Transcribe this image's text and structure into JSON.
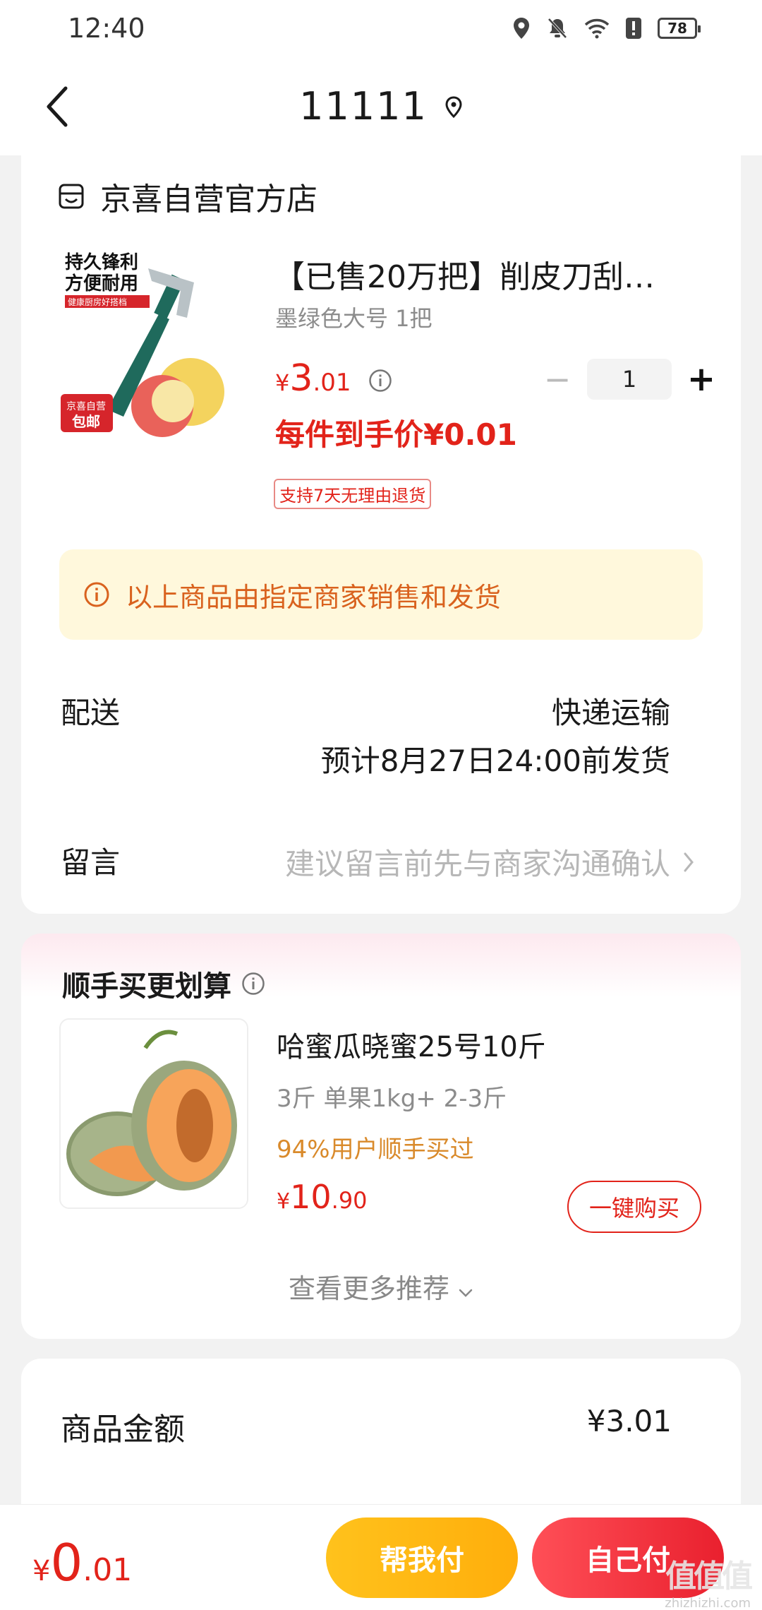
{
  "status_bar": {
    "time": "12:40",
    "battery": "78"
  },
  "header": {
    "title": "11111"
  },
  "store": {
    "name": "京喜自营官方店"
  },
  "product": {
    "image_text_line1": "持久锋利",
    "image_text_line2": "方便耐用",
    "image_text_line3": "健康厨房好搭档",
    "image_tag_line1": "京喜自营",
    "image_tag_line2": "包邮",
    "title": "【已售20万把】削皮刀刮…",
    "spec": "墨绿色大号 1把",
    "price_currency": "¥",
    "price_int": "3",
    "price_dec": ".01",
    "quantity": "1",
    "minus_label": "−",
    "plus_label": "+",
    "deal_price": "每件到手价¥0.01",
    "badge": "支持7天无理由退货"
  },
  "notice": {
    "text": "以上商品由指定商家销售和发货"
  },
  "delivery": {
    "label": "配送",
    "method": "快递运输",
    "eta": "预计8月27日24:00前发货"
  },
  "message": {
    "label": "留言",
    "placeholder": "建议留言前先与商家沟通确认"
  },
  "recommend": {
    "title": "顺手买更划算",
    "item": {
      "name": "哈蜜瓜晓蜜25号10斤",
      "spec": "3斤 单果1kg+ 2-3斤",
      "social_proof": "94%用户顺手买过",
      "price_currency": "¥",
      "price_int": "10",
      "price_dec": ".90",
      "buy_label": "一键购买"
    },
    "more_label": "查看更多推荐"
  },
  "amount": {
    "label": "商品金额",
    "value": "¥3.01"
  },
  "bottom": {
    "total_currency": "¥",
    "total_int": "0",
    "total_dec": ".01",
    "help_pay_label": "帮我付",
    "self_pay_label": "自己付"
  },
  "watermark": {
    "big": "值值值",
    "small": "zhizhizhi.com"
  },
  "colors": {
    "accent_red": "#e2231a",
    "notice_bg": "#fff8dc",
    "notice_text": "#d9621e",
    "help_btn": "#ffb812",
    "self_btn": "#f0303c"
  }
}
